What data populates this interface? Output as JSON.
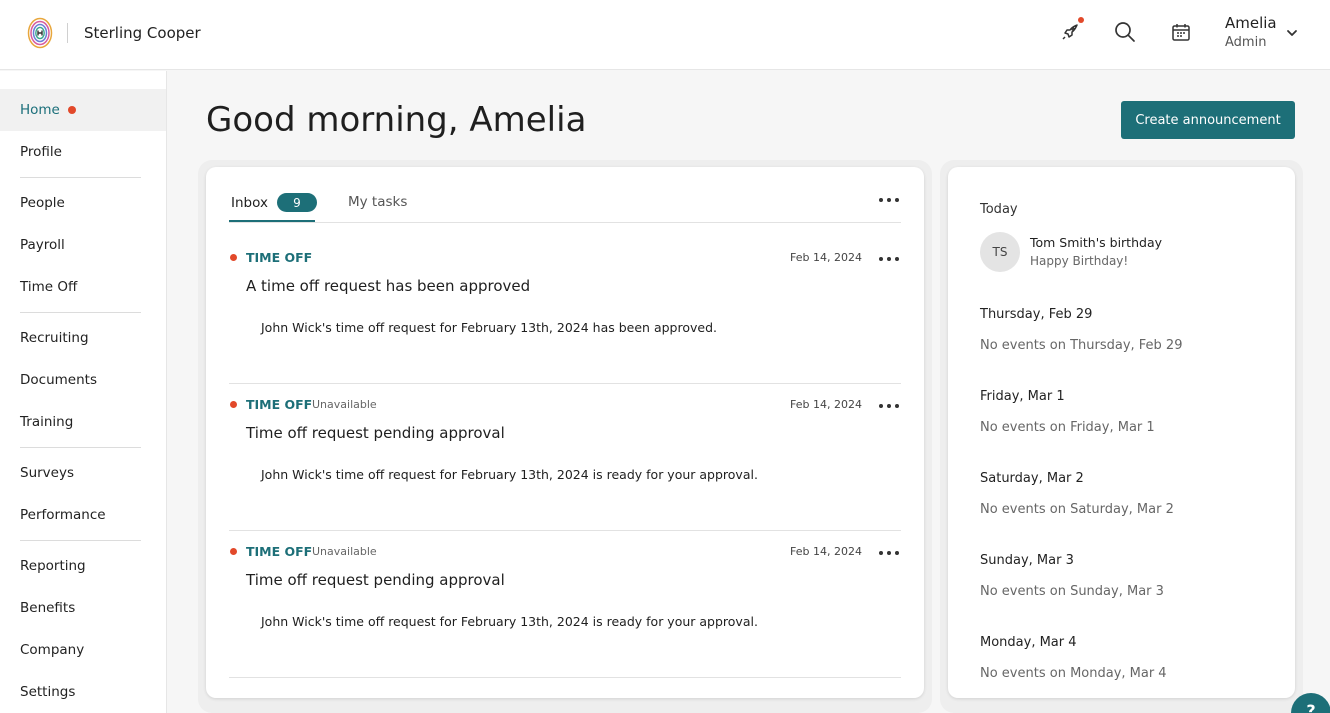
{
  "header": {
    "company": "Sterling Cooper",
    "user_name": "Amelia",
    "user_role": "Admin"
  },
  "icons": {
    "logo": "fingerprint-logo-icon",
    "rocket": "rocket-icon",
    "search": "search-icon",
    "calendar": "calendar-icon",
    "chevron": "chevron-down-icon",
    "more": "more-horizontal-icon"
  },
  "colors": {
    "accent": "#1d6f78",
    "alert": "#e2492a"
  },
  "sidebar": {
    "items": [
      {
        "label": "Home"
      },
      {
        "label": "Profile"
      },
      {
        "label": "People"
      },
      {
        "label": "Payroll"
      },
      {
        "label": "Time Off"
      },
      {
        "label": "Recruiting"
      },
      {
        "label": "Documents"
      },
      {
        "label": "Training"
      },
      {
        "label": "Surveys"
      },
      {
        "label": "Performance"
      },
      {
        "label": "Reporting"
      },
      {
        "label": "Benefits"
      },
      {
        "label": "Company"
      },
      {
        "label": "Settings"
      }
    ]
  },
  "main": {
    "greeting": "Good morning, Amelia",
    "create_button": "Create announcement"
  },
  "inbox": {
    "tab_inbox": "Inbox",
    "inbox_count": "9",
    "tab_tasks": "My tasks",
    "messages": [
      {
        "category": "TIME OFF",
        "status": "",
        "date": "Feb 14, 2024",
        "title": "A time off request has been approved",
        "body": "John Wick's time off request for February 13th, 2024 has been approved."
      },
      {
        "category": "TIME OFF",
        "status": "Unavailable",
        "date": "Feb 14, 2024",
        "title": "Time off request pending approval",
        "body": "John Wick's time off request for February 13th, 2024 is ready for your approval."
      },
      {
        "category": "TIME OFF",
        "status": "Unavailable",
        "date": "Feb 14, 2024",
        "title": "Time off request pending approval",
        "body": "John Wick's time off request for February 13th, 2024 is ready for your approval."
      }
    ]
  },
  "calendar": {
    "today_label": "Today",
    "birthday": {
      "initials": "TS",
      "title": "Tom Smith's birthday",
      "subtitle": "Happy Birthday!"
    },
    "days": [
      {
        "label": "Thursday, Feb 29",
        "empty": "No events on Thursday, Feb 29"
      },
      {
        "label": "Friday, Mar 1",
        "empty": "No events on Friday, Mar 1"
      },
      {
        "label": "Saturday, Mar 2",
        "empty": "No events on Saturday, Mar 2"
      },
      {
        "label": "Sunday, Mar 3",
        "empty": "No events on Sunday, Mar 3"
      },
      {
        "label": "Monday, Mar 4",
        "empty": "No events on Monday, Mar 4"
      }
    ]
  },
  "help": {
    "label": "?"
  }
}
